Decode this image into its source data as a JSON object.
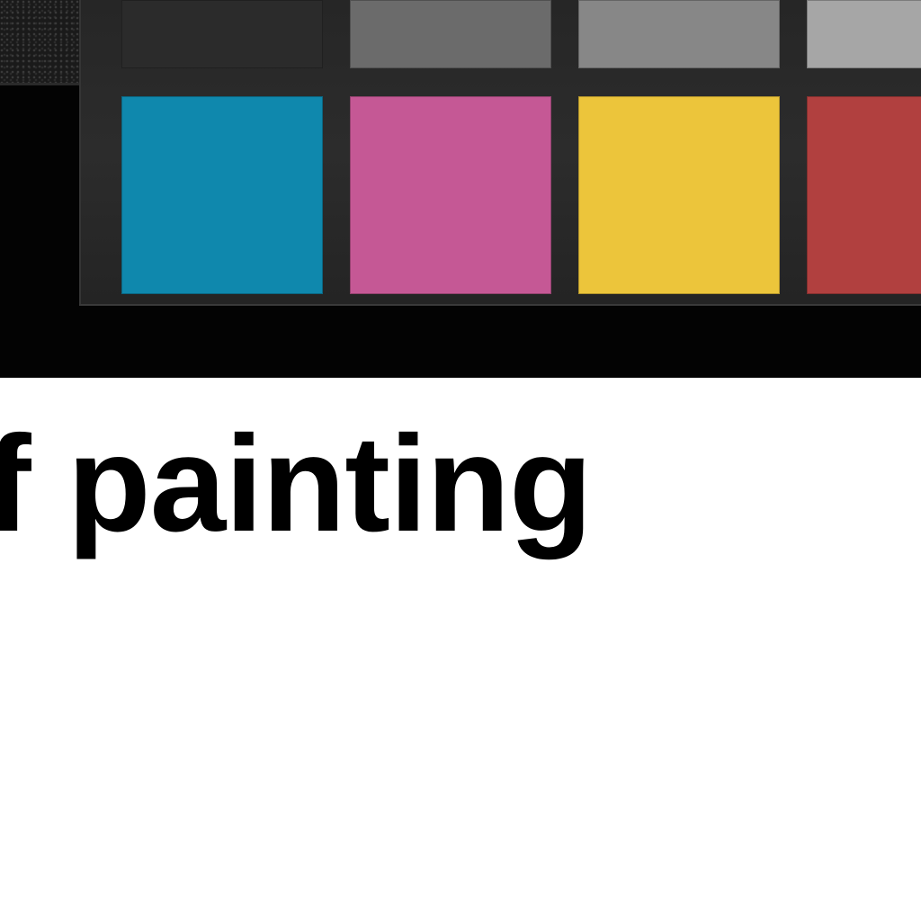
{
  "heading": {
    "text": "f painting",
    "color": "#000000"
  },
  "background": {
    "page": "#ffffff",
    "photo_backdrop": "#030303",
    "card": "#282828"
  },
  "color_checker": {
    "top_row": [
      {
        "name": "dark-gray",
        "color": "#2b2b2b"
      },
      {
        "name": "medium-gray",
        "color": "#6b6b6b"
      },
      {
        "name": "light-medium-gray",
        "color": "#878787"
      },
      {
        "name": "light-gray",
        "color": "#a6a6a6"
      }
    ],
    "bottom_row": [
      {
        "name": "cyan",
        "color": "#0f88ad"
      },
      {
        "name": "magenta",
        "color": "#c55895"
      },
      {
        "name": "yellow",
        "color": "#ecc53b"
      },
      {
        "name": "red",
        "color": "#b1403f"
      }
    ]
  }
}
